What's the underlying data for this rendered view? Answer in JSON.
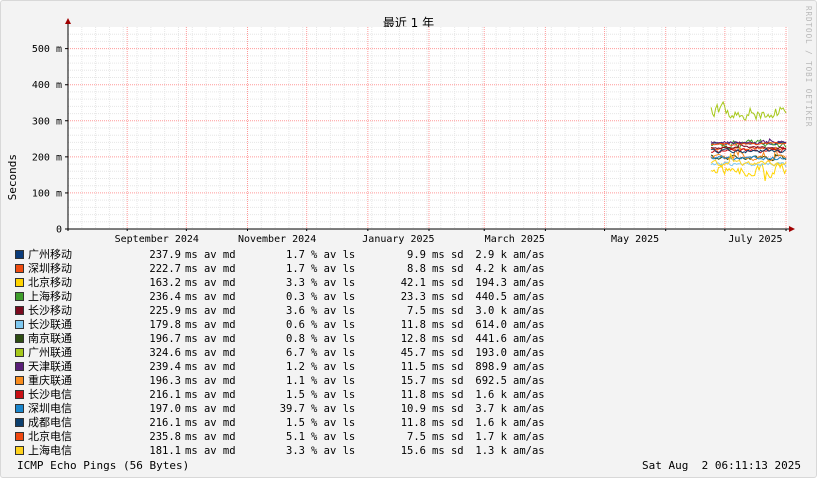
{
  "chart_data": {
    "type": "line",
    "title": "最近 1 年",
    "ylabel": "Seconds",
    "watermark": "RRDTOOL / TOBI OETIKER",
    "y_ticks": [
      "0",
      "100 m",
      "200 m",
      "300 m",
      "400 m",
      "500 m"
    ],
    "ylim": [
      0,
      0.56
    ],
    "x_ticks": [
      "September 2024",
      "November 2024",
      "January 2025",
      "March 2025",
      "May 2025",
      "July 2025"
    ],
    "x_range": [
      "2024-08-02",
      "2025-08-02"
    ],
    "data_start": "2025-06-24",
    "grid": true,
    "colors": {
      "background": "#f3f3f3",
      "canvas": "#ffffff",
      "grid_minor": "#e6e6e6",
      "grid_major": "#ff9a9a",
      "axis": "#000000",
      "arrow": "#a00000"
    },
    "series": [
      {
        "name": "广州移动",
        "color": "#0b3b7a",
        "median": "237.9",
        "med_unit": "ms av md",
        "loss": "1.7",
        "loss_unit": "% av ls",
        "sd": "9.9",
        "sd_unit": "ms sd",
        "amas": "2.9 k",
        "amas_unit": "am/as"
      },
      {
        "name": "深圳移动",
        "color": "#ee4c10",
        "median": "222.7",
        "med_unit": "ms av md",
        "loss": "1.7",
        "loss_unit": "% av ls",
        "sd": "8.8",
        "sd_unit": "ms sd",
        "amas": "4.2 k",
        "amas_unit": "am/as"
      },
      {
        "name": "北京移动",
        "color": "#ffd400",
        "median": "163.2",
        "med_unit": "ms av md",
        "loss": "3.3",
        "loss_unit": "% av ls",
        "sd": "42.1",
        "sd_unit": "ms sd",
        "amas": "194.3",
        "amas_unit": "am/as"
      },
      {
        "name": "上海移动",
        "color": "#3f9e2c",
        "median": "236.4",
        "med_unit": "ms av md",
        "loss": "0.3",
        "loss_unit": "% av ls",
        "sd": "23.3",
        "sd_unit": "ms sd",
        "amas": "440.5",
        "amas_unit": "am/as"
      },
      {
        "name": "长沙移动",
        "color": "#7a0a1e",
        "median": "225.9",
        "med_unit": "ms av md",
        "loss": "3.6",
        "loss_unit": "% av ls",
        "sd": "7.5",
        "sd_unit": "ms sd",
        "amas": "3.0 k",
        "amas_unit": "am/as"
      },
      {
        "name": "长沙联通",
        "color": "#7fc8f0",
        "median": "179.8",
        "med_unit": "ms av md",
        "loss": "0.6",
        "loss_unit": "% av ls",
        "sd": "11.8",
        "sd_unit": "ms sd",
        "amas": "614.0",
        "amas_unit": "am/as"
      },
      {
        "name": "南京联通",
        "color": "#2e4d12",
        "median": "196.7",
        "med_unit": "ms av md",
        "loss": "0.8",
        "loss_unit": "% av ls",
        "sd": "12.8",
        "sd_unit": "ms sd",
        "amas": "441.6",
        "amas_unit": "am/as"
      },
      {
        "name": "广州联通",
        "color": "#a6c81a",
        "median": "324.6",
        "med_unit": "ms av md",
        "loss": "6.7",
        "loss_unit": "% av ls",
        "sd": "45.7",
        "sd_unit": "ms sd",
        "amas": "193.0",
        "amas_unit": "am/as"
      },
      {
        "name": "天津联通",
        "color": "#5a1e78",
        "median": "239.4",
        "med_unit": "ms av md",
        "loss": "1.2",
        "loss_unit": "% av ls",
        "sd": "11.5",
        "sd_unit": "ms sd",
        "amas": "898.9",
        "amas_unit": "am/as"
      },
      {
        "name": "重庆联通",
        "color": "#f88c1e",
        "median": "196.3",
        "med_unit": "ms av md",
        "loss": "1.1",
        "loss_unit": "% av ls",
        "sd": "15.7",
        "sd_unit": "ms sd",
        "amas": "692.5",
        "amas_unit": "am/as"
      },
      {
        "name": "长沙电信",
        "color": "#c80f14",
        "median": "216.1",
        "med_unit": "ms av md",
        "loss": "1.5",
        "loss_unit": "% av ls",
        "sd": "11.8",
        "sd_unit": "ms sd",
        "amas": "1.6 k",
        "amas_unit": "am/as"
      },
      {
        "name": "深圳电信",
        "color": "#1a86cc",
        "median": "197.0",
        "med_unit": "ms av md",
        "loss": "39.7",
        "loss_unit": "% av ls",
        "sd": "10.9",
        "sd_unit": "ms sd",
        "amas": "3.7 k",
        "amas_unit": "am/as"
      },
      {
        "name": "成都电信",
        "color": "#0c3f6e",
        "median": "216.1",
        "med_unit": "ms av md",
        "loss": "1.5",
        "loss_unit": "% av ls",
        "sd": "11.8",
        "sd_unit": "ms sd",
        "amas": "1.6 k",
        "amas_unit": "am/as"
      },
      {
        "name": "北京电信",
        "color": "#f04810",
        "median": "235.8",
        "med_unit": "ms av md",
        "loss": "5.1",
        "loss_unit": "% av ls",
        "sd": "7.5",
        "sd_unit": "ms sd",
        "amas": "1.7 k",
        "amas_unit": "am/as"
      },
      {
        "name": "上海电信",
        "color": "#ffd21e",
        "median": "181.1",
        "med_unit": "ms av md",
        "loss": "3.3",
        "loss_unit": "% av ls",
        "sd": "15.6",
        "sd_unit": "ms sd",
        "amas": "1.3 k",
        "amas_unit": "am/as"
      }
    ]
  },
  "footer": {
    "left": "ICMP Echo Pings (56 Bytes)",
    "right": "Sat Aug  2 06:11:13 2025"
  }
}
